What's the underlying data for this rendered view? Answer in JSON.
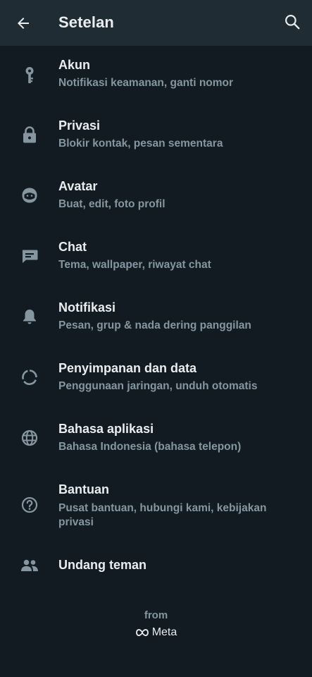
{
  "app_bar": {
    "title": "Setelan",
    "back_icon": "arrow-left-icon",
    "search_icon": "search-icon"
  },
  "settings": [
    {
      "icon": "key-icon",
      "label": "Akun",
      "sub": "Notifikasi keamanan, ganti nomor"
    },
    {
      "icon": "lock-icon",
      "label": "Privasi",
      "sub": "Blokir kontak, pesan sementara"
    },
    {
      "icon": "avatar-face-icon",
      "label": "Avatar",
      "sub": "Buat, edit, foto profil"
    },
    {
      "icon": "chat-icon",
      "label": "Chat",
      "sub": "Tema, wallpaper, riwayat chat"
    },
    {
      "icon": "bell-icon",
      "label": "Notifikasi",
      "sub": "Pesan, grup & nada dering panggilan"
    },
    {
      "icon": "data-usage-icon",
      "label": "Penyimpanan dan data",
      "sub": "Penggunaan jaringan, unduh otomatis"
    },
    {
      "icon": "globe-icon",
      "label": "Bahasa aplikasi",
      "sub": "Bahasa Indonesia (bahasa telepon)"
    },
    {
      "icon": "help-icon",
      "label": "Bantuan",
      "sub": "Pusat bantuan, hubungi kami, kebijakan privasi"
    },
    {
      "icon": "people-icon",
      "label": "Undang teman"
    }
  ],
  "footer": {
    "from": "from",
    "brand": "Meta"
  },
  "colors": {
    "background": "#111b21",
    "app_bar": "#1f2c34",
    "primary_text": "#e9edef",
    "secondary_text": "#8696a0",
    "icon": "#8696a0"
  }
}
